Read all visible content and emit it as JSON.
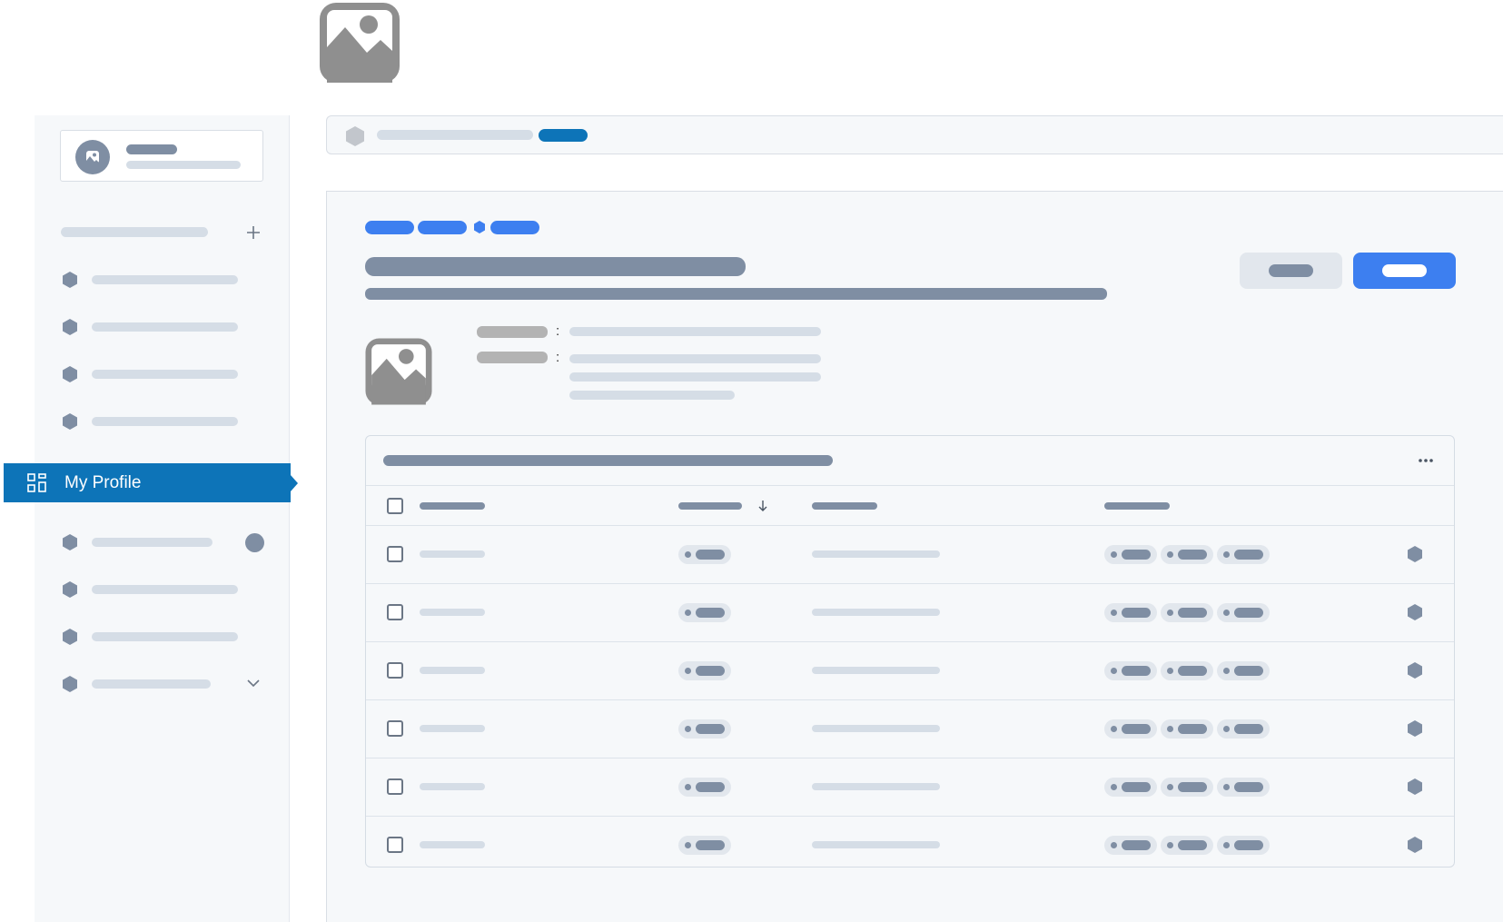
{
  "app": {
    "logo_icon": "image-placeholder-icon"
  },
  "sidebar": {
    "profile_avatar_icon": "image-placeholder-icon",
    "add_icon": "plus-icon",
    "active_item": {
      "label": "My Profile",
      "icon": "grid-icon"
    },
    "expand_icon": "chevron-down-icon"
  },
  "main": {
    "more_icon": "ellipsis-icon",
    "sort_icon": "arrow-down-icon",
    "detail_separator": ":",
    "image_icon": "image-placeholder-icon"
  },
  "colors": {
    "accent": "#0d74b8",
    "primary_button": "#3d7ff0",
    "secondary_button": "#e2e7ed",
    "placeholder_dark": "#7f8ea3",
    "placeholder_light": "#d5dde6"
  }
}
